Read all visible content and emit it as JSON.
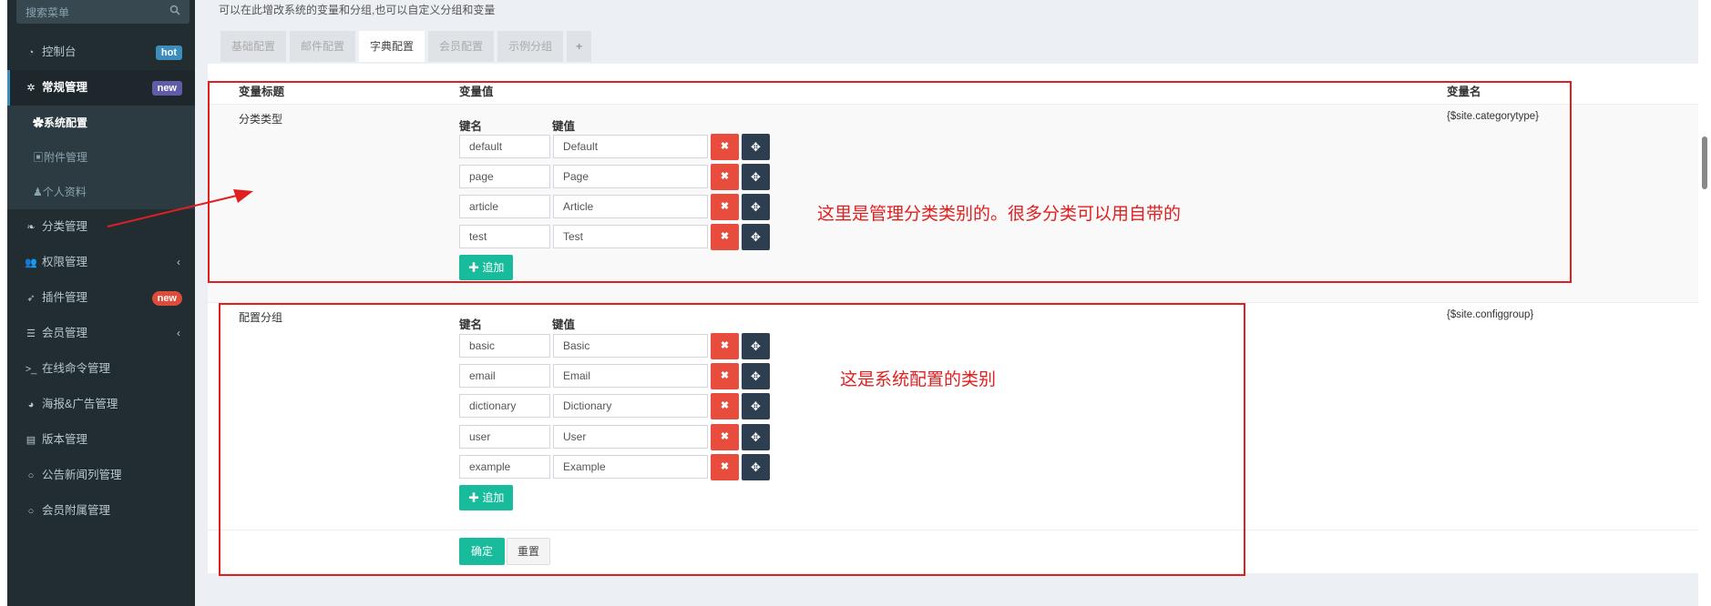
{
  "sidebar": {
    "search_placeholder": "搜索菜单",
    "items": [
      {
        "icon": "dashboard-icon",
        "glyph": "◔",
        "label": "控制台",
        "badge": "hot"
      },
      {
        "icon": "cogs-icon",
        "glyph": "✲",
        "label": "常规管理",
        "badge": "new"
      },
      {
        "icon": "leaf-icon",
        "glyph": "❧",
        "label": "分类管理"
      },
      {
        "icon": "group-icon",
        "glyph": "👥",
        "label": "权限管理"
      },
      {
        "icon": "rocket-icon",
        "glyph": "➶",
        "label": "插件管理",
        "badge": "new"
      },
      {
        "icon": "list-icon",
        "glyph": "☰",
        "label": "会员管理"
      },
      {
        "icon": "terminal-icon",
        "glyph": ">_",
        "label": "在线命令管理"
      },
      {
        "icon": "pie-chart-icon",
        "glyph": "◕",
        "label": "海报&广告管理"
      },
      {
        "icon": "file-icon",
        "glyph": "▤",
        "label": "版本管理"
      },
      {
        "icon": "circle-icon",
        "glyph": "○",
        "label": "公告新闻列管理"
      },
      {
        "icon": "circle-icon",
        "glyph": "○",
        "label": "会员附属管理"
      }
    ],
    "submenu": [
      {
        "icon": "gear-icon",
        "glyph": "✿",
        "label": "系统配置"
      },
      {
        "icon": "image-icon",
        "glyph": "▣",
        "label": "附件管理"
      },
      {
        "icon": "user-icon",
        "glyph": "♟",
        "label": "个人资料"
      }
    ]
  },
  "main": {
    "tip": "可以在此增改系统的变量和分组,也可以自定义分组和变量",
    "tabs": [
      "基础配置",
      "邮件配置",
      "字典配置",
      "会员配置",
      "示例分组",
      "+"
    ],
    "columns": {
      "title": "变量标题",
      "value": "变量值",
      "name": "变量名"
    },
    "kv_headers": {
      "key": "键名",
      "value": "键值"
    },
    "rows": [
      {
        "title": "分类类型",
        "name": "{$site.categorytype}",
        "pairs": [
          {
            "key": "default",
            "value": "Default"
          },
          {
            "key": "page",
            "value": "Page"
          },
          {
            "key": "article",
            "value": "Article"
          },
          {
            "key": "test",
            "value": "Test"
          }
        ]
      },
      {
        "title": "配置分组",
        "name": "{$site.configgroup}",
        "pairs": [
          {
            "key": "basic",
            "value": "Basic"
          },
          {
            "key": "email",
            "value": "Email"
          },
          {
            "key": "dictionary",
            "value": "Dictionary"
          },
          {
            "key": "user",
            "value": "User"
          },
          {
            "key": "example",
            "value": "Example"
          }
        ]
      }
    ],
    "add_label": "✚ 追加",
    "ok_label": "确定",
    "reset_label": "重置"
  },
  "annotations": {
    "note1": "这里是管理分类类别的。很多分类可以用自带的",
    "note2": "这是系统配置的类别",
    "color": "#e02020"
  },
  "colors": {
    "sidebar_bg": "#222d32",
    "accent_green": "#18bc9c",
    "delete_red": "#e74c3c",
    "move_dark": "#2c3e50"
  }
}
